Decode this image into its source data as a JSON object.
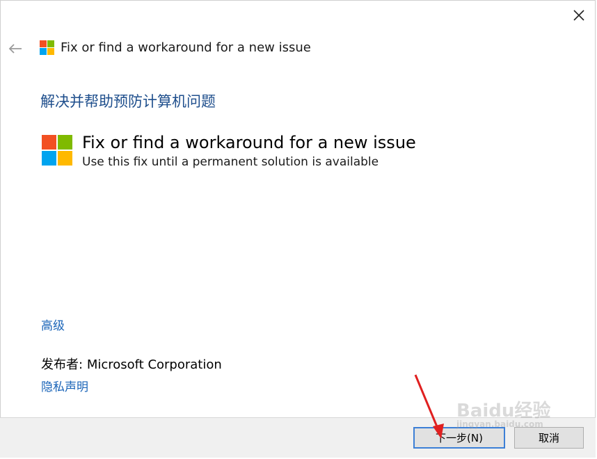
{
  "window": {
    "title": "Fix or find a workaround for a new issue",
    "close_icon": "close-icon",
    "back_icon": "back-arrow-icon"
  },
  "main": {
    "heading": "解决并帮助预防计算机问题",
    "item": {
      "title": "Fix or find a workaround for a new issue",
      "subtitle": "Use this fix until a permanent solution is available",
      "icon": "windows-logo-icon"
    },
    "advanced_link": "高级",
    "publisher_label": "发布者:",
    "publisher_value": "Microsoft Corporation",
    "privacy_link": "隐私声明"
  },
  "footer": {
    "next_label": "下一步(N)",
    "cancel_label": "取消"
  },
  "watermark": {
    "brand": "Baidu经验",
    "url": "jingyan.baidu.com"
  },
  "colors": {
    "heading": "#1e4e8c",
    "link": "#1a64b8",
    "logo_red": "#f25022",
    "logo_green": "#7fba00",
    "logo_blue": "#00a4ef",
    "logo_yellow": "#ffb900",
    "annotation_arrow": "#e02020"
  }
}
